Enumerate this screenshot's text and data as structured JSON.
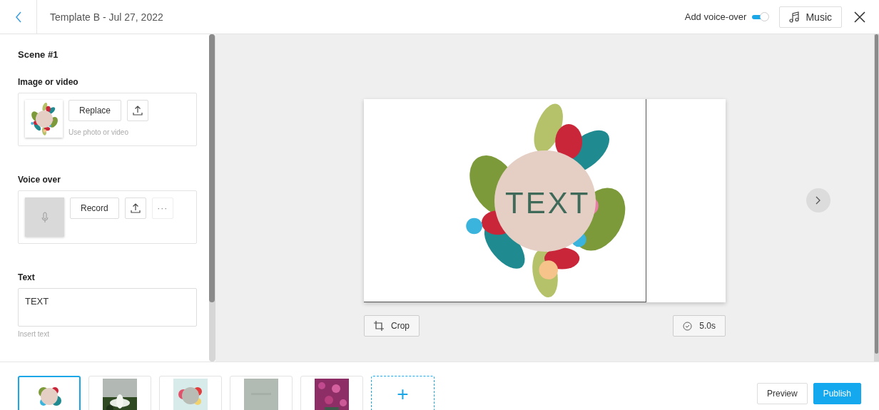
{
  "header": {
    "title": "Template B - Jul 27, 2022",
    "voice_over_toggle": {
      "label": "Add voice-over",
      "on": true
    },
    "music_button": "Music"
  },
  "scene": {
    "title": "Scene #1",
    "image_section": {
      "label": "Image or video",
      "replace_button": "Replace",
      "hint": "Use photo or video"
    },
    "voice_section": {
      "label": "Voice over",
      "record_button": "Record",
      "more_button": "···"
    },
    "text_section": {
      "label": "Text",
      "value": "TEXT",
      "hint": "Insert text"
    }
  },
  "stage": {
    "canvas_text": "TEXT",
    "crop_button": "Crop",
    "duration_button": "5.0s"
  },
  "filmstrip": {
    "thumbnails": [
      {
        "kind": "wreath",
        "selected": true
      },
      {
        "kind": "flower",
        "selected": false
      },
      {
        "kind": "roses",
        "selected": false
      },
      {
        "kind": "plain",
        "selected": false
      },
      {
        "kind": "meadow",
        "selected": false
      }
    ],
    "add_button": "+"
  },
  "footer_buttons": {
    "preview": "Preview",
    "publish": "Publish"
  }
}
